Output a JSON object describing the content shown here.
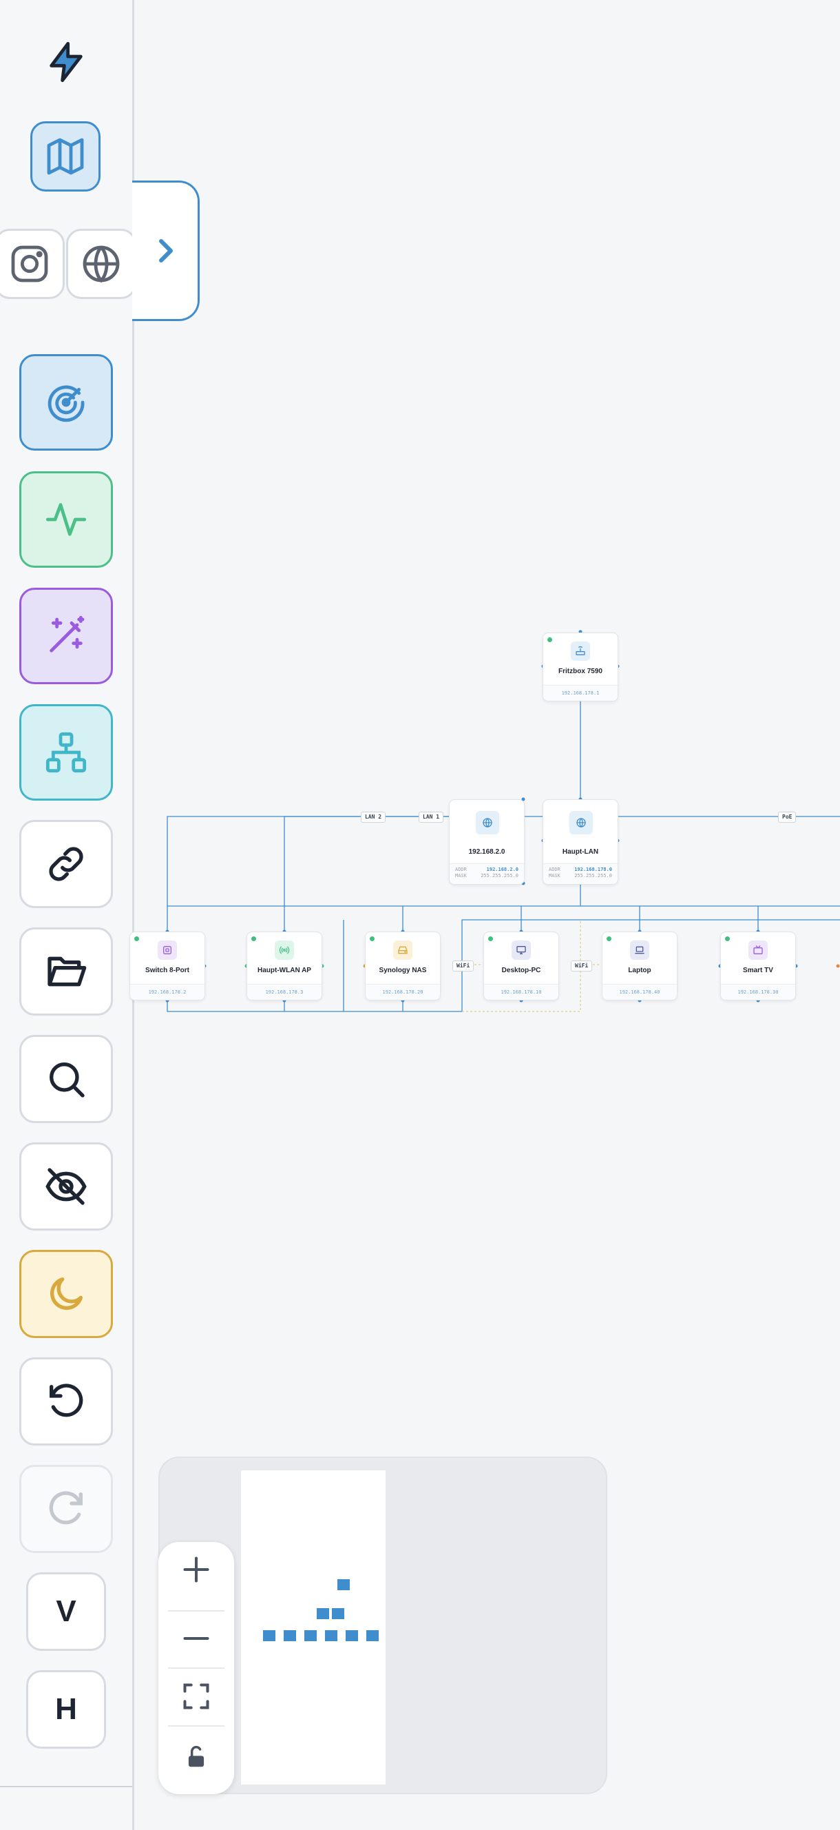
{
  "sidebar": {
    "toolbar": [
      {
        "name": "logo",
        "icon": "bolt-icon"
      },
      {
        "name": "map-view",
        "icon": "map-icon"
      },
      {
        "name": "instagram",
        "icon": "instagram-icon"
      },
      {
        "name": "web",
        "icon": "globe-icon"
      },
      {
        "name": "scan",
        "icon": "radar-icon"
      },
      {
        "name": "monitor",
        "icon": "activity-icon"
      },
      {
        "name": "auto-layout",
        "icon": "magic-wand-icon"
      },
      {
        "name": "topology",
        "icon": "network-icon"
      },
      {
        "name": "connect",
        "icon": "link-icon"
      },
      {
        "name": "open",
        "icon": "folder-open-icon"
      },
      {
        "name": "search",
        "icon": "search-icon"
      },
      {
        "name": "hide",
        "icon": "eye-off-icon"
      },
      {
        "name": "theme",
        "icon": "moon-icon"
      },
      {
        "name": "undo",
        "icon": "undo-icon"
      },
      {
        "name": "redo",
        "icon": "redo-icon"
      }
    ],
    "vertical_label": "V",
    "horizontal_label": "H"
  },
  "colors": {
    "accent": "#3f8dcc",
    "green": "#4cbf88",
    "purple": "#9a5be0",
    "cyan": "#42b6c9",
    "amber": "#d8a93c"
  },
  "nodes": {
    "fritzbox": {
      "name": "Fritzbox 7590",
      "ip": "192.168.178.1",
      "icon": "router-icon"
    },
    "subnet2": {
      "name": "192.168.2.0",
      "icon": "globe-icon",
      "addr_label": "ADDR",
      "addr": "192.168.2.0",
      "mask_label": "MASK",
      "mask": "255.255.255.0"
    },
    "haupt_lan": {
      "name": "Haupt-LAN",
      "icon": "globe-icon",
      "addr_label": "ADDR",
      "addr": "192.168.178.0",
      "mask_label": "MASK",
      "mask": "255.255.255.0"
    },
    "switch": {
      "name": "Switch 8-Port",
      "ip": "192.168.178.2",
      "icon": "switch-icon"
    },
    "wlan_ap": {
      "name": "Haupt-WLAN AP",
      "ip": "192.168.178.3",
      "icon": "wifi-icon"
    },
    "nas": {
      "name": "Synology NAS",
      "ip": "192.168.178.20",
      "icon": "hard-drive-icon"
    },
    "desktop": {
      "name": "Desktop-PC",
      "ip": "192.168.178.10",
      "icon": "monitor-icon"
    },
    "laptop": {
      "name": "Laptop",
      "ip": "192.168.178.40",
      "icon": "laptop-icon"
    },
    "tv": {
      "name": "Smart TV",
      "ip": "192.168.178.30",
      "icon": "tv-icon"
    }
  },
  "edge_labels": {
    "lan2": "LAN 2",
    "lan1": "LAN 1",
    "poe": "PoE",
    "wifi_a": "WiFi",
    "wifi_b": "WiFi"
  },
  "controls": [
    {
      "name": "zoom-in",
      "icon": "plus-icon"
    },
    {
      "name": "zoom-out",
      "icon": "minus-icon"
    },
    {
      "name": "fit-view",
      "icon": "fit-icon"
    },
    {
      "name": "lock",
      "icon": "unlock-icon"
    }
  ]
}
